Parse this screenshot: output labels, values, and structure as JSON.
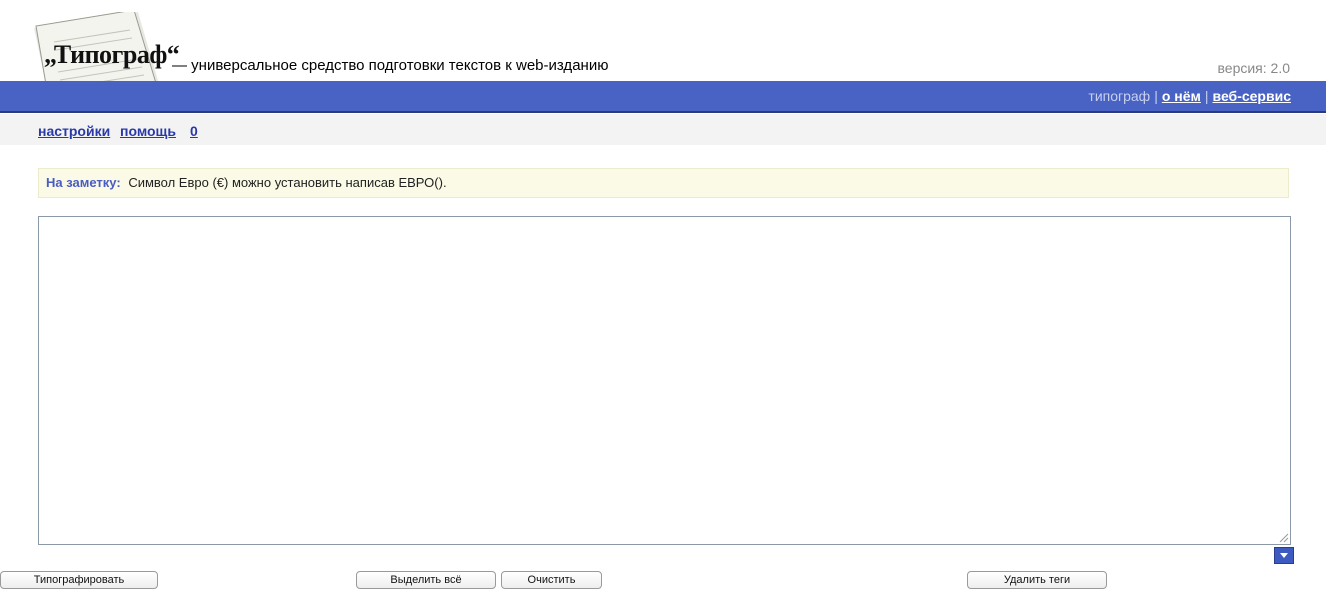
{
  "header": {
    "logo_text": "„Типограф“",
    "tagline": "— универсальное средство подготовки текстов к web-изданию",
    "version": "версия: 2.0"
  },
  "nav": {
    "current": "типограф",
    "separator": "|",
    "about": "о нём",
    "web_service": "веб-сервис"
  },
  "toolbar": {
    "settings": "настройки",
    "help": "помощь",
    "count": "0"
  },
  "note": {
    "label": "На заметку:",
    "text": "Символ Евро (€) можно установить написав ЕВРО()."
  },
  "editor": {
    "value": ""
  },
  "buttons": {
    "typograph": "Типографировать",
    "select_all": "Выделить всё",
    "clear": "Очистить",
    "remove_tags": "Удалить теги"
  },
  "colors": {
    "bar": "#4863c4",
    "link": "#2a39a8",
    "note_bg": "#fafae6"
  }
}
